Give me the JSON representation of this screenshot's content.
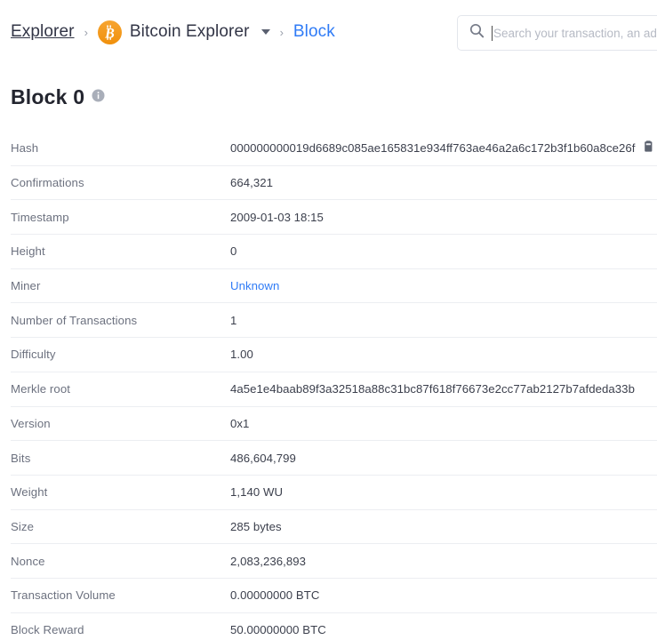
{
  "header": {
    "breadcrumb": {
      "root_label": "Explorer",
      "separator": "›",
      "chain_label": "Bitcoin Explorer",
      "chain_icon": "bitcoin-logo-icon",
      "dropdown_icon": "chevron-down-icon",
      "current_label": "Block"
    },
    "search": {
      "icon": "search-icon",
      "placeholder": "Search your transaction, an address, a block...",
      "value": ""
    }
  },
  "page": {
    "title": "Block 0",
    "info_icon": "info-icon"
  },
  "details": {
    "copy_icon": "copy-icon",
    "rows": [
      {
        "label": "Hash",
        "value": "000000000019d6689c085ae165831e934ff763ae46a2a6c172b3f1b60a8ce26f",
        "copyable": true,
        "link": false
      },
      {
        "label": "Confirmations",
        "value": "664,321",
        "copyable": false,
        "link": false
      },
      {
        "label": "Timestamp",
        "value": "2009-01-03 18:15",
        "copyable": false,
        "link": false
      },
      {
        "label": "Height",
        "value": "0",
        "copyable": false,
        "link": false
      },
      {
        "label": "Miner",
        "value": "Unknown",
        "copyable": false,
        "link": true
      },
      {
        "label": "Number of Transactions",
        "value": "1",
        "copyable": false,
        "link": false
      },
      {
        "label": "Difficulty",
        "value": "1.00",
        "copyable": false,
        "link": false
      },
      {
        "label": "Merkle root",
        "value": "4a5e1e4baab89f3a32518a88c31bc87f618f76673e2cc77ab2127b7afdeda33b",
        "copyable": false,
        "link": false
      },
      {
        "label": "Version",
        "value": "0x1",
        "copyable": false,
        "link": false
      },
      {
        "label": "Bits",
        "value": "486,604,799",
        "copyable": false,
        "link": false
      },
      {
        "label": "Weight",
        "value": "1,140 WU",
        "copyable": false,
        "link": false
      },
      {
        "label": "Size",
        "value": "285 bytes",
        "copyable": false,
        "link": false
      },
      {
        "label": "Nonce",
        "value": "2,083,236,893",
        "copyable": false,
        "link": false
      },
      {
        "label": "Transaction Volume",
        "value": "0.00000000 BTC",
        "copyable": false,
        "link": false
      },
      {
        "label": "Block Reward",
        "value": "50.00000000 BTC",
        "copyable": false,
        "link": false
      }
    ]
  },
  "colors": {
    "accent_link": "#2f7bf6",
    "bitcoin_orange": "#f7931a",
    "label_gray": "#6c717f",
    "value_dark": "#3b3f4c",
    "divider": "#eceef2"
  }
}
